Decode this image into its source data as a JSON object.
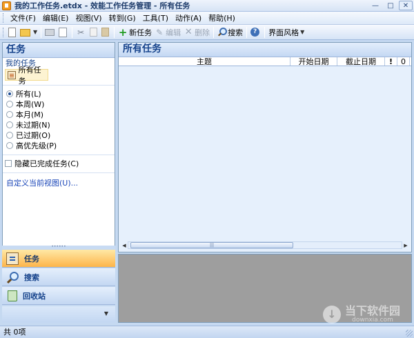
{
  "window": {
    "title": "我的工作任务.etdx - 效能工作任务管理 - 所有任务",
    "minimize": "—",
    "maximize": "□",
    "close": "✕"
  },
  "menu": [
    "文件(F)",
    "编辑(E)",
    "视图(V)",
    "转到(G)",
    "工具(T)",
    "动作(A)",
    "帮助(H)"
  ],
  "toolbar": {
    "new_task": "新任务",
    "edit": "编辑",
    "delete": "删除",
    "search": "搜索",
    "theme": "界面风格"
  },
  "left_panel": {
    "header": "任务",
    "my_tasks": "我的任务",
    "all_tasks": "所有任务",
    "filters": [
      {
        "label": "所有(L)",
        "selected": true
      },
      {
        "label": "本周(W)",
        "selected": false
      },
      {
        "label": "本月(M)",
        "selected": false
      },
      {
        "label": "未过期(N)",
        "selected": false
      },
      {
        "label": "已过期(O)",
        "selected": false
      },
      {
        "label": "高优先级(P)",
        "selected": false
      }
    ],
    "hide_completed": "隐藏已完成任务(C)",
    "customize_view": "自定义当前视图(U)..."
  },
  "nav": {
    "tasks": "任务",
    "search": "搜索",
    "recycle": "回收站"
  },
  "main": {
    "header": "所有任务",
    "columns": {
      "subject": "主题",
      "start_date": "开始日期",
      "due_date": "截止日期",
      "flag": "!",
      "attachment": "0"
    }
  },
  "watermark": {
    "title": "当下软件园",
    "sub": "downxia.com"
  },
  "status": "共 0项"
}
